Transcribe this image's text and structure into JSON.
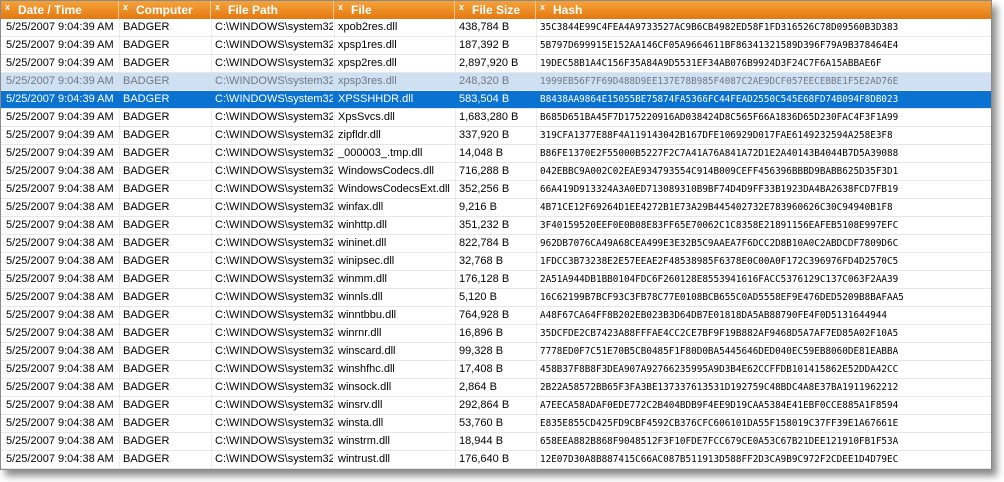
{
  "columns": [
    {
      "label": "Date / Time"
    },
    {
      "label": "Computer"
    },
    {
      "label": "File Path"
    },
    {
      "label": "File"
    },
    {
      "label": "File Size"
    },
    {
      "label": "Hash"
    }
  ],
  "column_close_glyph": "x",
  "rows": [
    {
      "date": "5/25/2007 9:04:39 AM",
      "computer": "BADGER",
      "path": "C:\\WINDOWS\\system32",
      "file": "xpob2res.dll",
      "size": "438,784 B",
      "hash": "35C3844E99C4FEA4A9733527AC9B6CB4982ED58F1FD316526C78D09560B3D383",
      "state": ""
    },
    {
      "date": "5/25/2007 9:04:39 AM",
      "computer": "BADGER",
      "path": "C:\\WINDOWS\\system32",
      "file": "xpsp1res.dll",
      "size": "187,392 B",
      "hash": "5B797D699915E152AA146CF05A9664611BF86341321589D396F79A9B378464E4",
      "state": ""
    },
    {
      "date": "5/25/2007 9:04:39 AM",
      "computer": "BADGER",
      "path": "C:\\WINDOWS\\system32",
      "file": "xpsp2res.dll",
      "size": "2,897,920 B",
      "hash": "19DEC58B1A4C156F35A84A9D5531EF34AB076B9924D3F24C7F6A15ABBAE6F",
      "state": ""
    },
    {
      "date": "5/25/2007 9:04:39 AM",
      "computer": "BADGER",
      "path": "C:\\WINDOWS\\system32",
      "file": "xpsp3res.dll",
      "size": "248,320 B",
      "hash": "1999EB56F7F69D488D9EE137E78B985F4087C2AE9DCF057EECEBBE1F5E2AD76E",
      "state": "hover"
    },
    {
      "date": "5/25/2007 9:04:39 AM",
      "computer": "BADGER",
      "path": "C:\\WINDOWS\\system32",
      "file": "XPSSHHDR.dll",
      "size": "583,504 B",
      "hash": "B8438AA9864E15055BE75874FA5366FC44FEAD2550C545E68FD74B094F8DB023",
      "state": "selected"
    },
    {
      "date": "5/25/2007 9:04:39 AM",
      "computer": "BADGER",
      "path": "C:\\WINDOWS\\system32",
      "file": "XpsSvcs.dll",
      "size": "1,683,280 B",
      "hash": "B685D651BA45F7D175220916AD038424D8C565F66A1836D65D230FAC4F3F1A99",
      "state": ""
    },
    {
      "date": "5/25/2007 9:04:39 AM",
      "computer": "BADGER",
      "path": "C:\\WINDOWS\\system32",
      "file": "zipfldr.dll",
      "size": "337,920 B",
      "hash": "319CFA1377E88F4A119143042B167DFE106929D017FAE6149232594A258E3F8",
      "state": ""
    },
    {
      "date": "5/25/2007 9:04:39 AM",
      "computer": "BADGER",
      "path": "C:\\WINDOWS\\system32",
      "file": "_000003_.tmp.dll",
      "size": "14,048 B",
      "hash": "B86FE1370E2F55000B5227F2C7A41A76A841A72D1E2A40143B4044B7D5A39088",
      "state": ""
    },
    {
      "date": "5/25/2007 9:04:38 AM",
      "computer": "BADGER",
      "path": "C:\\WINDOWS\\system32",
      "file": "WindowsCodecs.dll",
      "size": "716,288 B",
      "hash": "042EBBC9A002C02EAE934793554C914B009CEFF456396BBBD9BABB625D35F3D1",
      "state": ""
    },
    {
      "date": "5/25/2007 9:04:38 AM",
      "computer": "BADGER",
      "path": "C:\\WINDOWS\\system32",
      "file": "WindowsCodecsExt.dll",
      "size": "352,256 B",
      "hash": "66A419D913324A3A0ED713089310B9BF74D4D9FF33B1923DA4BA2638FCD7FB19",
      "state": ""
    },
    {
      "date": "5/25/2007 9:04:38 AM",
      "computer": "BADGER",
      "path": "C:\\WINDOWS\\system32",
      "file": "winfax.dll",
      "size": "9,216 B",
      "hash": "4B71CE12F69264D1EE4272B1E73A29B445402732E783960626C30C94940B1F8",
      "state": ""
    },
    {
      "date": "5/25/2007 9:04:38 AM",
      "computer": "BADGER",
      "path": "C:\\WINDOWS\\system32",
      "file": "winhttp.dll",
      "size": "351,232 B",
      "hash": "3F40159520EEF0E0B08E83FF65E70062C1C8358E21891156EAFEB5108E997EFC",
      "state": ""
    },
    {
      "date": "5/25/2007 9:04:38 AM",
      "computer": "BADGER",
      "path": "C:\\WINDOWS\\system32",
      "file": "wininet.dll",
      "size": "822,784 B",
      "hash": "962DB7076CA49A68CEA499E3E32B5C9AAEA7F6DCC2D8B10A0C2ABDCDF7809D6C",
      "state": ""
    },
    {
      "date": "5/25/2007 9:04:38 AM",
      "computer": "BADGER",
      "path": "C:\\WINDOWS\\system32",
      "file": "winipsec.dll",
      "size": "32,768 B",
      "hash": "1FDCC3B73238E2E57EEAE2F48538985F6378E0C00A0F172C396976FD4D2570C5",
      "state": ""
    },
    {
      "date": "5/25/2007 9:04:38 AM",
      "computer": "BADGER",
      "path": "C:\\WINDOWS\\system32",
      "file": "winmm.dll",
      "size": "176,128 B",
      "hash": "2A51A944DB1BB0104FDC6F260128E8553941616FACC5376129C137C063F2AA39",
      "state": ""
    },
    {
      "date": "5/25/2007 9:04:38 AM",
      "computer": "BADGER",
      "path": "C:\\WINDOWS\\system32",
      "file": "winnls.dll",
      "size": "5,120 B",
      "hash": "16C62199B7BCF93C3FB78C77E0108BCB655C0AD5558EF9E476DED5209B8BAFAA5",
      "state": ""
    },
    {
      "date": "5/25/2007 9:04:38 AM",
      "computer": "BADGER",
      "path": "C:\\WINDOWS\\system32",
      "file": "winntbbu.dll",
      "size": "764,928 B",
      "hash": "A48F67CA64FF8B202EB023B3D64DB7E01818DA5AB88790FE4F0D5131644944",
      "state": ""
    },
    {
      "date": "5/25/2007 9:04:38 AM",
      "computer": "BADGER",
      "path": "C:\\WINDOWS\\system32",
      "file": "winrnr.dll",
      "size": "16,896 B",
      "hash": "35DCFDE2CB7423A88FFFAE4CC2CE7BF9F19B882AF9468D5A7AF7ED85A02F10A5",
      "state": ""
    },
    {
      "date": "5/25/2007 9:04:38 AM",
      "computer": "BADGER",
      "path": "C:\\WINDOWS\\system32",
      "file": "winscard.dll",
      "size": "99,328 B",
      "hash": "7778ED0F7C51E70B5CB0485F1F80D0BA5445646DED040EC59EB8060DE81EABBA",
      "state": ""
    },
    {
      "date": "5/25/2007 9:04:38 AM",
      "computer": "BADGER",
      "path": "C:\\WINDOWS\\system32",
      "file": "winshfhc.dll",
      "size": "17,408 B",
      "hash": "458B37F8B8F3DEA907A92766235995A9D3B4E62CCFFDB101415862E52DDA42CC",
      "state": ""
    },
    {
      "date": "5/25/2007 9:04:38 AM",
      "computer": "BADGER",
      "path": "C:\\WINDOWS\\system32",
      "file": "winsock.dll",
      "size": "2,864 B",
      "hash": "2B22A58572BB65F3FA3BE137337613531D192759C48BDC4A8E37BA1911962212",
      "state": ""
    },
    {
      "date": "5/25/2007 9:04:38 AM",
      "computer": "BADGER",
      "path": "C:\\WINDOWS\\system32",
      "file": "winsrv.dll",
      "size": "292,864 B",
      "hash": "A7EECA58ADAF0EDE772C2B404BDB9F4EE9D19CAA5384E41EBF0CCE885A1F8594",
      "state": ""
    },
    {
      "date": "5/25/2007 9:04:38 AM",
      "computer": "BADGER",
      "path": "C:\\WINDOWS\\system32",
      "file": "winsta.dll",
      "size": "53,760 B",
      "hash": "E835E855CD425FD9CBF4592CB376CFC606101DA55F158019C37FF39E1A67661E",
      "state": ""
    },
    {
      "date": "5/25/2007 9:04:38 AM",
      "computer": "BADGER",
      "path": "C:\\WINDOWS\\system32",
      "file": "winstrm.dll",
      "size": "18,944 B",
      "hash": "658EEA882B868F9048512F3F10FDE7FCC679CE0A53C67B21DEE121910FB1F53A",
      "state": ""
    },
    {
      "date": "5/25/2007 9:04:38 AM",
      "computer": "BADGER",
      "path": "C:\\WINDOWS\\system32",
      "file": "wintrust.dll",
      "size": "176,640 B",
      "hash": "12E07D30A8B887415C66AC087B511913D588FF2D3CA9B9C972F2CDEE1D4D79EC",
      "state": ""
    }
  ],
  "colors": {
    "header_top": "#f5a23b",
    "header_bottom": "#e4780f",
    "selected_row": "#0a73d1",
    "hover_row": "#cfe0f2"
  }
}
